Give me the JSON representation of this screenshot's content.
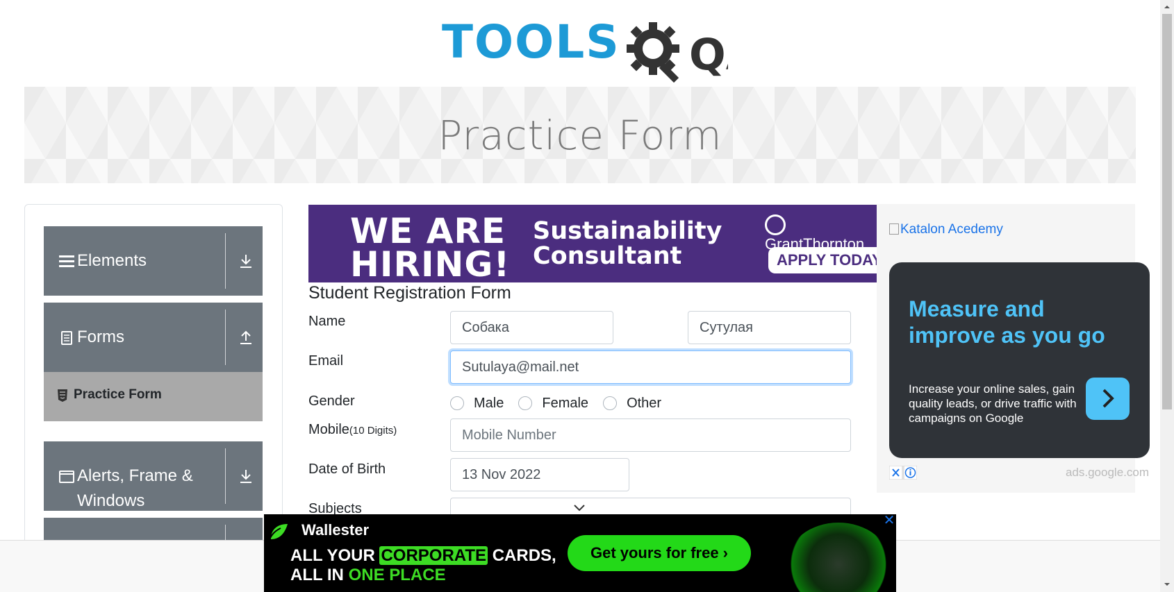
{
  "header": {
    "logo_text": "TOOLS",
    "logo_suffix": "QA"
  },
  "banner": {
    "title": "Practice Form"
  },
  "sidebar": {
    "groups": [
      {
        "label": "Elements",
        "icon": "hamburger-icon",
        "state": "collapsed"
      },
      {
        "label": "Forms",
        "icon": "document-icon",
        "state": "expanded"
      },
      {
        "label": "Alerts, Frame & Windows",
        "label_line1": "Alerts, Frame &",
        "label_line2": "Windows",
        "icon": "window-icon",
        "state": "collapsed"
      }
    ],
    "active_item": {
      "label": "Practice Form",
      "icon": "html5-icon"
    }
  },
  "ad_top": {
    "headline_line1": "WE ARE",
    "headline_line2": "HIRING!",
    "role_line1": "Sustainability",
    "role_line2": "Consultant",
    "brand": "GrantThornton",
    "cta": "APPLY TODAY"
  },
  "form": {
    "title": "Student Registration Form",
    "name_label": "Name",
    "first_name_value": "Собака",
    "last_name_value": "Сутулая",
    "email_label": "Email",
    "email_value": "Sutulaya@mail.net",
    "gender_label": "Gender",
    "gender_options": [
      "Male",
      "Female",
      "Other"
    ],
    "mobile_label": "Mobile",
    "mobile_hint": "(10 Digits)",
    "mobile_placeholder": "Mobile Number",
    "dob_label": "Date of Birth",
    "dob_value": "13 Nov 2022",
    "subjects_label": "Subjects"
  },
  "ad_right": {
    "image_alt": "Katalon Acedemy",
    "headline_line1": "Measure and",
    "headline_line2": "improve as you go",
    "description": "Increase your online sales, gain quality leads, or drive traffic with campaigns on Google",
    "source": "ads.google.com"
  },
  "ad_bottom": {
    "brand": "Wallester",
    "line1_a": "ALL YOUR ",
    "line1_hl": "CORPORATE",
    "line1_b": " CARDS,",
    "line2_a": "ALL IN ",
    "line2_hl": "ONE PLACE",
    "cta": "Get yours for free ›",
    "close": "✕"
  },
  "colors": {
    "logo_blue": "#1d9ad6",
    "sidebar_group": "#6c757d",
    "sidebar_active": "#a9a9a9",
    "ad_purple": "#4b2d7f",
    "ad_cyan": "#4fc3f7",
    "wallester_green": "#23d918"
  }
}
